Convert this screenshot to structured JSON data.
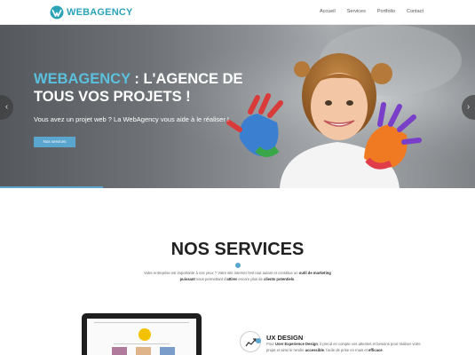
{
  "header": {
    "logo_text": "WEBAGENCY",
    "nav": [
      "Accueil",
      "Services",
      "Portfolio",
      "Contact"
    ]
  },
  "hero": {
    "title_brand": "WEBAGENCY",
    "title_rest": " : L'AGENCE DE TOUS VOS PROJETS !",
    "subtitle": "Vous avez un projet web ? La WebAgency vous aide à le réaliser !",
    "button_label": "Nos services",
    "arrow_left": "‹",
    "arrow_right": "›"
  },
  "services": {
    "title": "NOS SERVICES",
    "text_part1": "Votre entreprise est importante à vos yeux ? Votre site internet l'est tout autant et constitue un ",
    "text_bold1": "outil de marketing puissant",
    "text_part2": " vous permettant d'",
    "text_bold2": "attirer",
    "text_part3": " encore plus de ",
    "text_bold3": "clients potentiels",
    "text_part4": "."
  },
  "ux": {
    "title": "UX DESIGN",
    "text_part1": "Pour ",
    "text_bold1": "User Experience Design",
    "text_part2": ", il prend en compte vos attentes et besoins pour réaliser votre projet et ainsi le rendre ",
    "text_bold2": "accessible",
    "text_part3": ", facile de prise en main et ",
    "text_bold3": "efficace",
    "text_part4": "."
  },
  "colors": {
    "accent": "#5aa6cf",
    "brand": "#2ba4b8",
    "brand_light": "#5bc0de"
  }
}
